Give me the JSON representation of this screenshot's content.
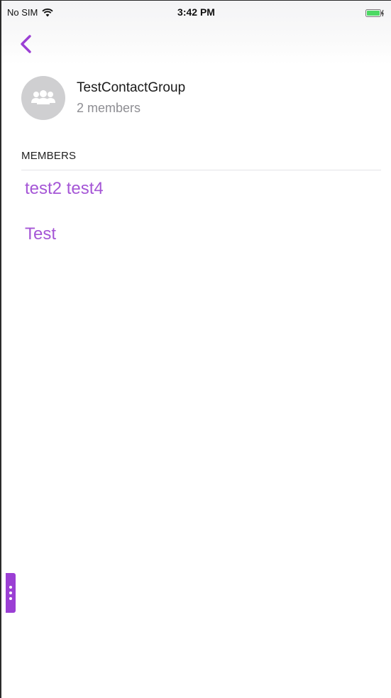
{
  "status_bar": {
    "carrier": "No SIM",
    "time": "3:42 PM"
  },
  "colors": {
    "accent": "#a556d6",
    "handle": "#9b3fd4",
    "battery": "#4cd964"
  },
  "group": {
    "name": "TestContactGroup",
    "member_count": "2 members",
    "avatar_icon": "group-icon"
  },
  "members_section": {
    "title": "MEMBERS",
    "items": [
      {
        "name": "test2 test4"
      },
      {
        "name": "Test"
      }
    ]
  }
}
